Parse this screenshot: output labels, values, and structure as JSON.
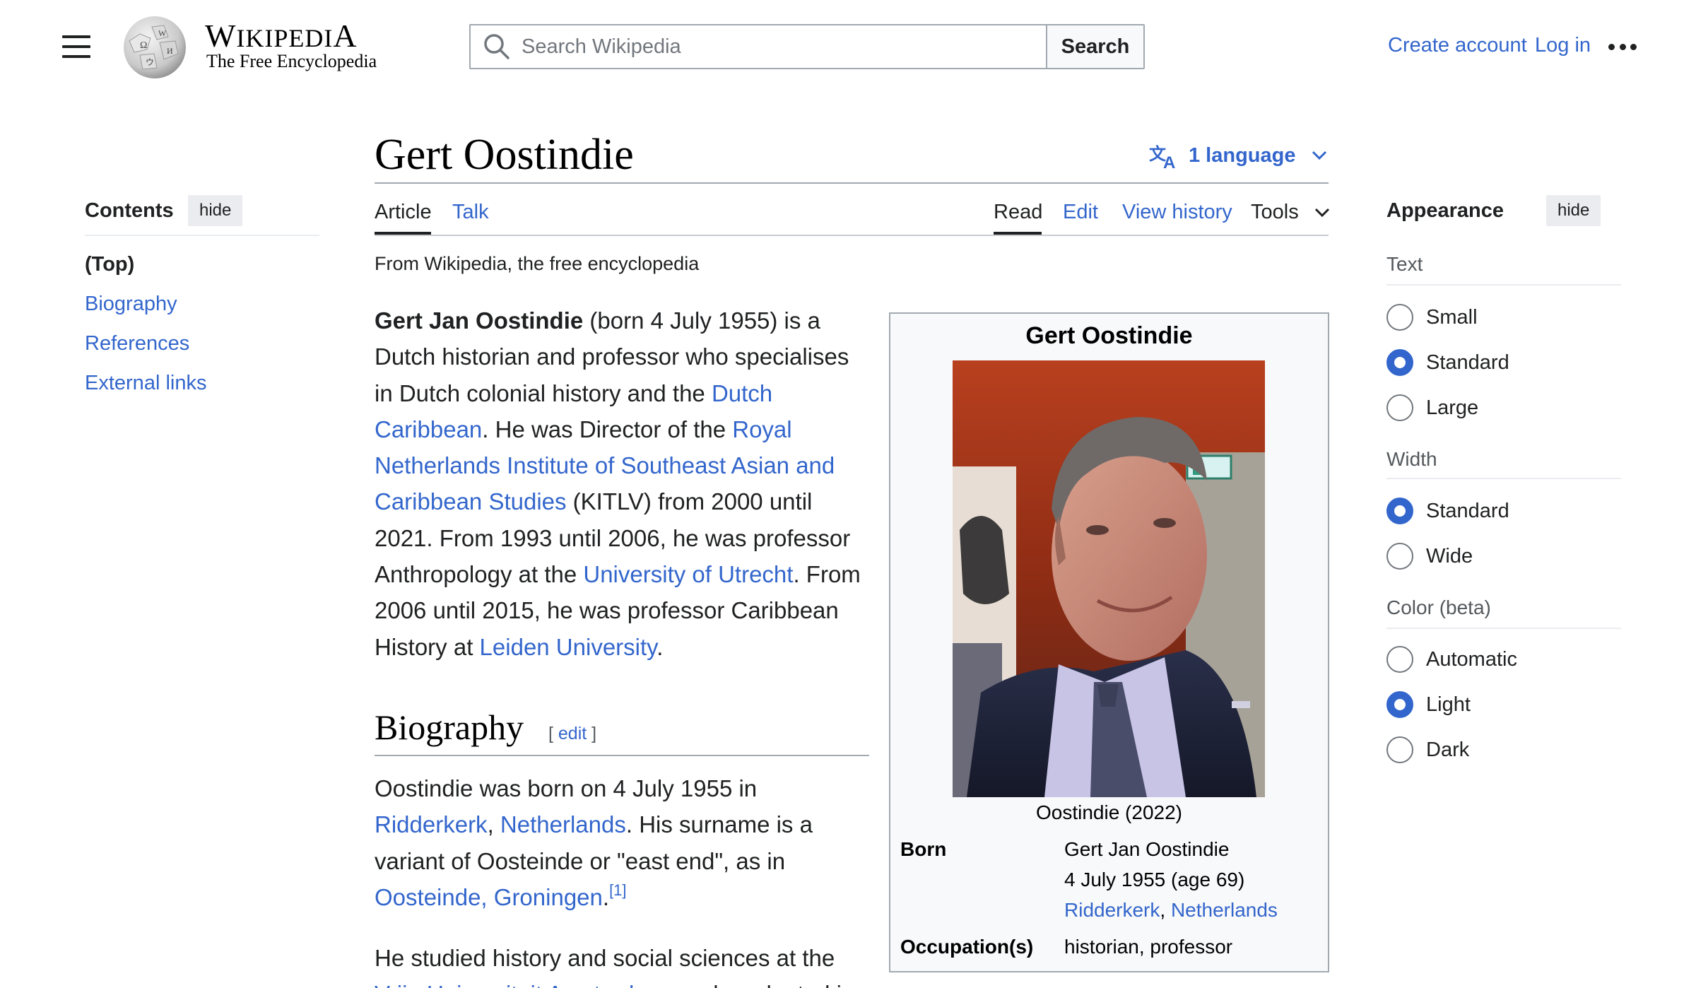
{
  "header": {
    "wordmark_first": "W",
    "wordmark_rest": "IKIPEDI",
    "wordmark_last": "A",
    "tagline": "The Free Encyclopedia",
    "search_placeholder": "Search Wikipedia",
    "search_button": "Search",
    "create_account": "Create account",
    "log_in": "Log in"
  },
  "article": {
    "title": "Gert Oostindie",
    "language_button": "1 language",
    "tabs": {
      "article": "Article",
      "talk": "Talk",
      "read": "Read",
      "edit": "Edit",
      "view_history": "View history",
      "tools": "Tools"
    },
    "from_wiki": "From Wikipedia, the free encyclopedia",
    "lead": {
      "bold_name": "Gert Jan Oostindie",
      "t1": " (born 4 July 1955) is a Dutch historian and professor who specialises in Dutch colonial history and the ",
      "link_dutch_caribbean": "Dutch Caribbean",
      "t2": ". He was Director of the ",
      "link_kitlv": "Royal Netherlands Institute of Southeast Asian and Caribbean Studies",
      "t3": " (KITLV) from 2000 until 2021. From 1993 until 2006, he was professor Anthropology at the ",
      "link_utrecht": "University of Utrecht",
      "t4": ". From 2006 until 2015, he was professor Caribbean History at ",
      "link_leiden": "Leiden University",
      "t5": "."
    },
    "biography": {
      "heading": "Biography",
      "edit_open": "[ ",
      "edit_label": "edit",
      "edit_close": " ]",
      "p1_t1": "Oostindie was born on 4 July 1955 in ",
      "p1_link_ridderkerk": "Ridderkerk",
      "p1_comma": ", ",
      "p1_link_netherlands": "Netherlands",
      "p1_t2": ". His surname is a variant of Oosteinde or \"east end\", as in ",
      "p1_link_oosteinde": "Oosteinde, Groningen",
      "p1_t3": ".",
      "p1_ref": "[1]",
      "p2_t1": "He studied history and social sciences at the ",
      "p2_link_vu": "Vrije Universiteit Amsterdam",
      "p2_t2": ", and graduated in"
    }
  },
  "infobox": {
    "title": "Gert Oostindie",
    "caption": "Oostindie (2022)",
    "born_label": "Born",
    "born_name": "Gert Jan Oostindie",
    "born_date": "4 July 1955 (age 69)",
    "born_place_link1": "Ridderkerk",
    "born_place_sep": ", ",
    "born_place_link2": "Netherlands",
    "occupation_label": "Occupation(s)",
    "occupation_value": "historian, professor"
  },
  "toc": {
    "title": "Contents",
    "hide": "hide",
    "items": [
      "(Top)",
      "Biography",
      "References",
      "External links"
    ]
  },
  "appearance": {
    "title": "Appearance",
    "hide": "hide",
    "text_label": "Text",
    "text_options": [
      "Small",
      "Standard",
      "Large"
    ],
    "text_selected": "Standard",
    "width_label": "Width",
    "width_options": [
      "Standard",
      "Wide"
    ],
    "width_selected": "Standard",
    "color_label": "Color (beta)",
    "color_options": [
      "Automatic",
      "Light",
      "Dark"
    ],
    "color_selected": "Light"
  },
  "colors": {
    "link": "#3366cc",
    "text": "#202122",
    "radio_selected": "#3366cc"
  }
}
